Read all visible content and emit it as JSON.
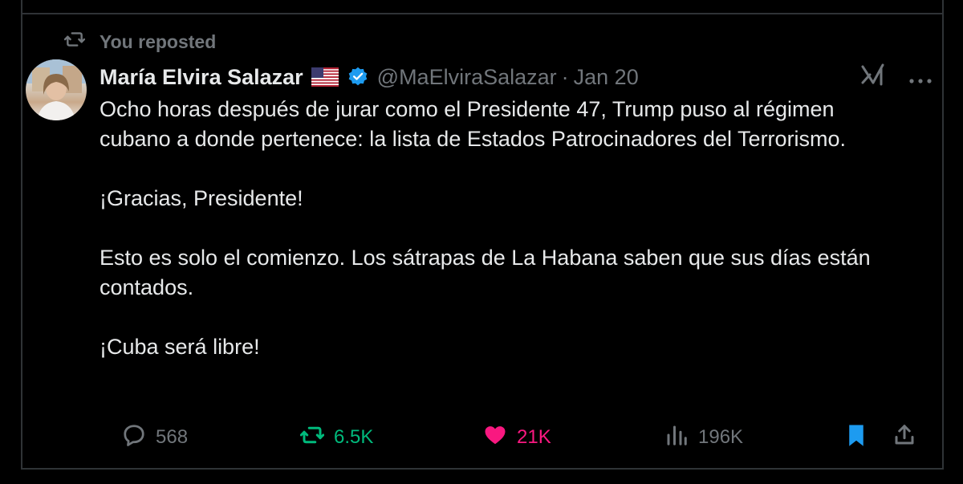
{
  "repost": {
    "label": "You reposted",
    "icon": "repost-icon"
  },
  "author": {
    "name": "María Elvira Salazar",
    "flag": "🇺🇸",
    "handle": "@MaElviraSalazar",
    "separator": "·",
    "date": "Jan 20",
    "verified": true
  },
  "header_icons": {
    "grok": "grok-icon",
    "more": "more-icon"
  },
  "post": {
    "p1": "Ocho horas después de jurar como el Presidente 47, Trump puso al régimen cubano a donde pertenece: la lista de Estados Patrocinadores del Terrorismo.",
    "p2": "¡Gracias, Presidente!",
    "p3": "Esto es solo el comienzo. Los sátrapas de La Habana saben que sus días están contados.",
    "p4": "¡Cuba será libre!"
  },
  "actions": {
    "replies": "568",
    "reposts": "6.5K",
    "likes": "21K",
    "views": "196K"
  },
  "colors": {
    "background": "#000000",
    "text": "#e7e9ea",
    "muted": "#71767b",
    "verified": "#1d9bf0",
    "repost_active": "#00ba7c",
    "like_active": "#f91880",
    "bookmark_active": "#1d9bf0",
    "border": "#2f3336"
  }
}
